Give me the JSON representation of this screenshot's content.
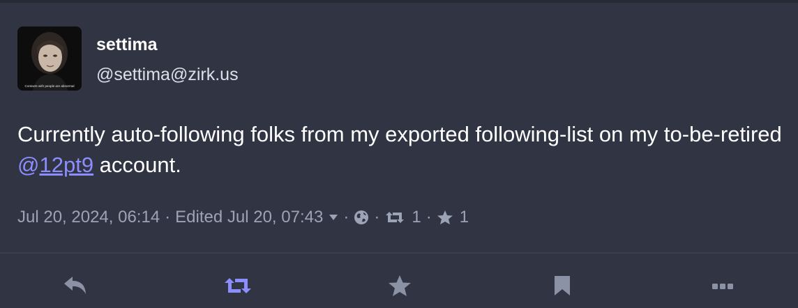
{
  "status": {
    "display_name": "settima",
    "acct": "@settima@zirk.us",
    "avatar_caption": "Contacts with people are abnormal",
    "content_before": "Currently auto-following folks from my exported following-list on my to-be-retired ",
    "mention_at": "@",
    "mention_user": "12pt9",
    "content_after": " account.",
    "timestamp": "Jul 20, 2024, 06:14",
    "separator": "·",
    "edited": "Edited Jul 20, 07:43",
    "visibility_icon": "globe-icon",
    "reblogs_count": "1",
    "favourites_count": "1"
  },
  "actions": [
    {
      "name": "reply",
      "icon": "reply-icon"
    },
    {
      "name": "boost",
      "icon": "boost-icon",
      "active": true
    },
    {
      "name": "favourite",
      "icon": "star-icon"
    },
    {
      "name": "bookmark",
      "icon": "bookmark-icon"
    },
    {
      "name": "more",
      "icon": "ellipsis-icon"
    }
  ],
  "colors": {
    "background": "#313543",
    "text": "#ffffff",
    "secondary_text": "#9ba3b5",
    "mention": "#8c8dff",
    "action_icon": "#8c92a6",
    "boost_active": "#8c8dff"
  }
}
